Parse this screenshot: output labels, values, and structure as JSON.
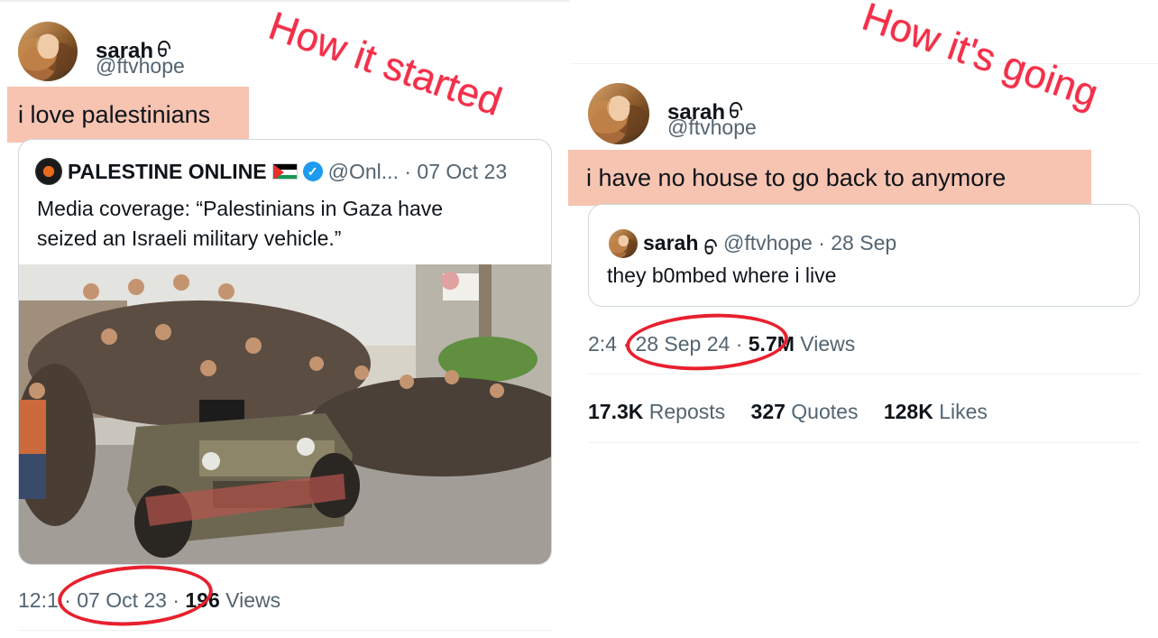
{
  "annotations": {
    "left": "How it started",
    "right": "How it's going"
  },
  "left_post": {
    "author_name": "sarah",
    "author_glyph": "ᠪ",
    "author_handle": "@ftvhope",
    "text": "i love palestinians",
    "quoted": {
      "name": "PALESTINE ONLINE",
      "handle_and_date": "@Onl... · 07 Oct 23",
      "body": "Media coverage: “Palestinians in Gaza have seized an Israeli military vehicle.”"
    },
    "meta": {
      "time": "12:1",
      "date": "07 Oct 23",
      "views_count": "196",
      "views_label": "Views"
    }
  },
  "right_post": {
    "author_name": "sarah",
    "author_glyph": "ᠪ",
    "author_handle": "@ftvhope",
    "text": "i have no house to go back to anymore",
    "quoted": {
      "name": "sarah",
      "handle_and_date": "@ftvhope · 28 Sep",
      "body": "they b0mbed where i live"
    },
    "meta": {
      "time": "2:4",
      "date": "28 Sep 24",
      "views_count": "5.7M",
      "views_label": "Views"
    },
    "stats": {
      "reposts_count": "17.3K",
      "reposts_label": "Reposts",
      "quotes_count": "327",
      "quotes_label": "Quotes",
      "likes_count": "128K",
      "likes_label": "Likes"
    }
  },
  "colors": {
    "annotation": "#f2304a",
    "highlight": "#f7c4b2",
    "circle": "#e8202e",
    "verified": "#1d9bf0",
    "muted": "#536471"
  }
}
